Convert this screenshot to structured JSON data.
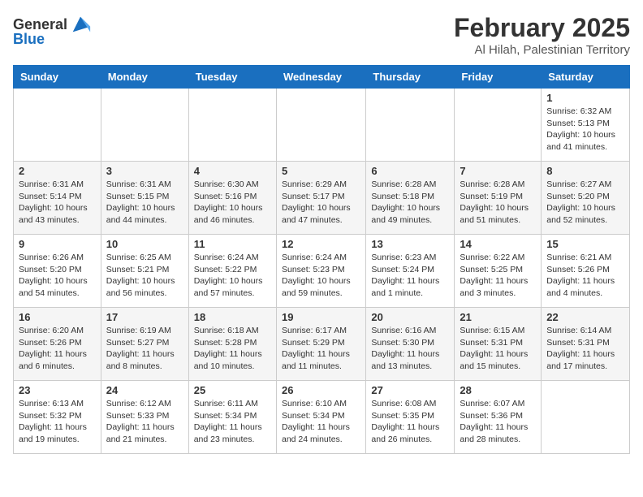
{
  "header": {
    "logo_general": "General",
    "logo_blue": "Blue",
    "month": "February 2025",
    "location": "Al Hilah, Palestinian Territory"
  },
  "weekdays": [
    "Sunday",
    "Monday",
    "Tuesday",
    "Wednesday",
    "Thursday",
    "Friday",
    "Saturday"
  ],
  "weeks": [
    [
      {
        "day": "",
        "info": ""
      },
      {
        "day": "",
        "info": ""
      },
      {
        "day": "",
        "info": ""
      },
      {
        "day": "",
        "info": ""
      },
      {
        "day": "",
        "info": ""
      },
      {
        "day": "",
        "info": ""
      },
      {
        "day": "1",
        "info": "Sunrise: 6:32 AM\nSunset: 5:13 PM\nDaylight: 10 hours and 41 minutes."
      }
    ],
    [
      {
        "day": "2",
        "info": "Sunrise: 6:31 AM\nSunset: 5:14 PM\nDaylight: 10 hours and 43 minutes."
      },
      {
        "day": "3",
        "info": "Sunrise: 6:31 AM\nSunset: 5:15 PM\nDaylight: 10 hours and 44 minutes."
      },
      {
        "day": "4",
        "info": "Sunrise: 6:30 AM\nSunset: 5:16 PM\nDaylight: 10 hours and 46 minutes."
      },
      {
        "day": "5",
        "info": "Sunrise: 6:29 AM\nSunset: 5:17 PM\nDaylight: 10 hours and 47 minutes."
      },
      {
        "day": "6",
        "info": "Sunrise: 6:28 AM\nSunset: 5:18 PM\nDaylight: 10 hours and 49 minutes."
      },
      {
        "day": "7",
        "info": "Sunrise: 6:28 AM\nSunset: 5:19 PM\nDaylight: 10 hours and 51 minutes."
      },
      {
        "day": "8",
        "info": "Sunrise: 6:27 AM\nSunset: 5:20 PM\nDaylight: 10 hours and 52 minutes."
      }
    ],
    [
      {
        "day": "9",
        "info": "Sunrise: 6:26 AM\nSunset: 5:20 PM\nDaylight: 10 hours and 54 minutes."
      },
      {
        "day": "10",
        "info": "Sunrise: 6:25 AM\nSunset: 5:21 PM\nDaylight: 10 hours and 56 minutes."
      },
      {
        "day": "11",
        "info": "Sunrise: 6:24 AM\nSunset: 5:22 PM\nDaylight: 10 hours and 57 minutes."
      },
      {
        "day": "12",
        "info": "Sunrise: 6:24 AM\nSunset: 5:23 PM\nDaylight: 10 hours and 59 minutes."
      },
      {
        "day": "13",
        "info": "Sunrise: 6:23 AM\nSunset: 5:24 PM\nDaylight: 11 hours and 1 minute."
      },
      {
        "day": "14",
        "info": "Sunrise: 6:22 AM\nSunset: 5:25 PM\nDaylight: 11 hours and 3 minutes."
      },
      {
        "day": "15",
        "info": "Sunrise: 6:21 AM\nSunset: 5:26 PM\nDaylight: 11 hours and 4 minutes."
      }
    ],
    [
      {
        "day": "16",
        "info": "Sunrise: 6:20 AM\nSunset: 5:26 PM\nDaylight: 11 hours and 6 minutes."
      },
      {
        "day": "17",
        "info": "Sunrise: 6:19 AM\nSunset: 5:27 PM\nDaylight: 11 hours and 8 minutes."
      },
      {
        "day": "18",
        "info": "Sunrise: 6:18 AM\nSunset: 5:28 PM\nDaylight: 11 hours and 10 minutes."
      },
      {
        "day": "19",
        "info": "Sunrise: 6:17 AM\nSunset: 5:29 PM\nDaylight: 11 hours and 11 minutes."
      },
      {
        "day": "20",
        "info": "Sunrise: 6:16 AM\nSunset: 5:30 PM\nDaylight: 11 hours and 13 minutes."
      },
      {
        "day": "21",
        "info": "Sunrise: 6:15 AM\nSunset: 5:31 PM\nDaylight: 11 hours and 15 minutes."
      },
      {
        "day": "22",
        "info": "Sunrise: 6:14 AM\nSunset: 5:31 PM\nDaylight: 11 hours and 17 minutes."
      }
    ],
    [
      {
        "day": "23",
        "info": "Sunrise: 6:13 AM\nSunset: 5:32 PM\nDaylight: 11 hours and 19 minutes."
      },
      {
        "day": "24",
        "info": "Sunrise: 6:12 AM\nSunset: 5:33 PM\nDaylight: 11 hours and 21 minutes."
      },
      {
        "day": "25",
        "info": "Sunrise: 6:11 AM\nSunset: 5:34 PM\nDaylight: 11 hours and 23 minutes."
      },
      {
        "day": "26",
        "info": "Sunrise: 6:10 AM\nSunset: 5:34 PM\nDaylight: 11 hours and 24 minutes."
      },
      {
        "day": "27",
        "info": "Sunrise: 6:08 AM\nSunset: 5:35 PM\nDaylight: 11 hours and 26 minutes."
      },
      {
        "day": "28",
        "info": "Sunrise: 6:07 AM\nSunset: 5:36 PM\nDaylight: 11 hours and 28 minutes."
      },
      {
        "day": "",
        "info": ""
      }
    ]
  ]
}
